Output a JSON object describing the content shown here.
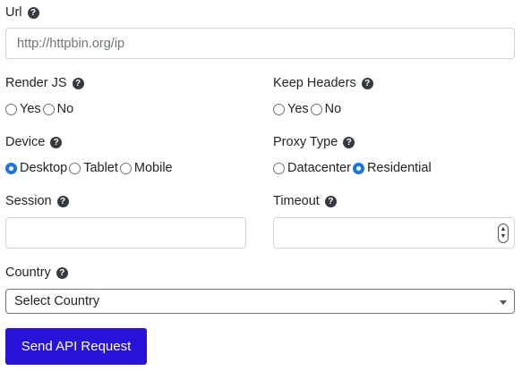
{
  "form": {
    "url": {
      "label": "Url",
      "placeholder": "http://httpbin.org/ip"
    },
    "render_js": {
      "label": "Render JS",
      "options": [
        "Yes",
        "No"
      ],
      "selected": null
    },
    "keep_headers": {
      "label": "Keep Headers",
      "options": [
        "Yes",
        "No"
      ],
      "selected": null
    },
    "device": {
      "label": "Device",
      "options": [
        "Desktop",
        "Tablet",
        "Mobile"
      ],
      "selected": "Desktop"
    },
    "proxy_type": {
      "label": "Proxy Type",
      "options": [
        "Datacenter",
        "Residential"
      ],
      "selected": "Residential"
    },
    "session": {
      "label": "Session",
      "value": ""
    },
    "timeout": {
      "label": "Timeout",
      "value": ""
    },
    "country": {
      "label": "Country",
      "selected": "Select Country"
    },
    "submit_label": "Send API Request"
  },
  "help_glyph": "?",
  "icons": {
    "help": "question-circle-icon",
    "spinner": "number-spinner-icon",
    "caret": "chevron-down-icon"
  },
  "colors": {
    "button": "#2a13d9",
    "radio_checked": "#1a73e8",
    "help_icon": "#343a40"
  }
}
